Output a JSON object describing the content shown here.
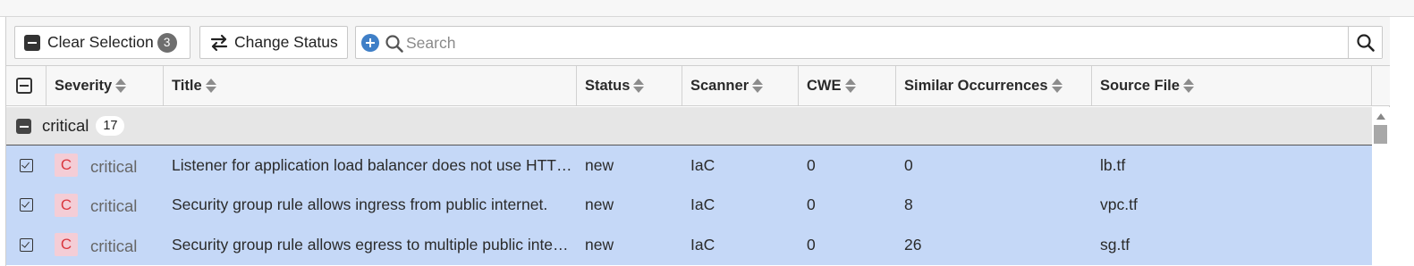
{
  "toolbar": {
    "clear_selection_label": "Clear Selection",
    "selected_count": "3",
    "change_status_label": "Change Status",
    "search_placeholder": "Search",
    "search_value": ""
  },
  "columns": {
    "severity": "Severity",
    "title": "Title",
    "status": "Status",
    "scanner": "Scanner",
    "cwe": "CWE",
    "similar": "Similar Occurrences",
    "source": "Source File"
  },
  "group": {
    "label": "critical",
    "count": "17"
  },
  "rows": [
    {
      "severity_badge": "C",
      "severity": "critical",
      "title": "Listener for application load balancer does not use HTTPS",
      "status": "new",
      "scanner": "IaC",
      "cwe": "0",
      "similar": "0",
      "source": "lb.tf",
      "selected": true
    },
    {
      "severity_badge": "C",
      "severity": "critical",
      "title": "Security group rule allows ingress from public internet.",
      "status": "new",
      "scanner": "IaC",
      "cwe": "0",
      "similar": "8",
      "source": "vpc.tf",
      "selected": true
    },
    {
      "severity_badge": "C",
      "severity": "critical",
      "title": "Security group rule allows egress to multiple public internet addresses.",
      "status": "new",
      "scanner": "IaC",
      "cwe": "0",
      "similar": "26",
      "source": "sg.tf",
      "selected": true
    }
  ],
  "colors": {
    "selected_row": "#c5d8f7",
    "severity_critical_bg": "#f4cdd6",
    "severity_critical_fg": "#d9363e",
    "add_filter_icon": "#3f7fc7"
  },
  "icons": {
    "clear": "minus-square-icon",
    "change_status": "swap-arrows-icon",
    "add_filter": "plus-circle-icon",
    "search": "search-icon"
  }
}
